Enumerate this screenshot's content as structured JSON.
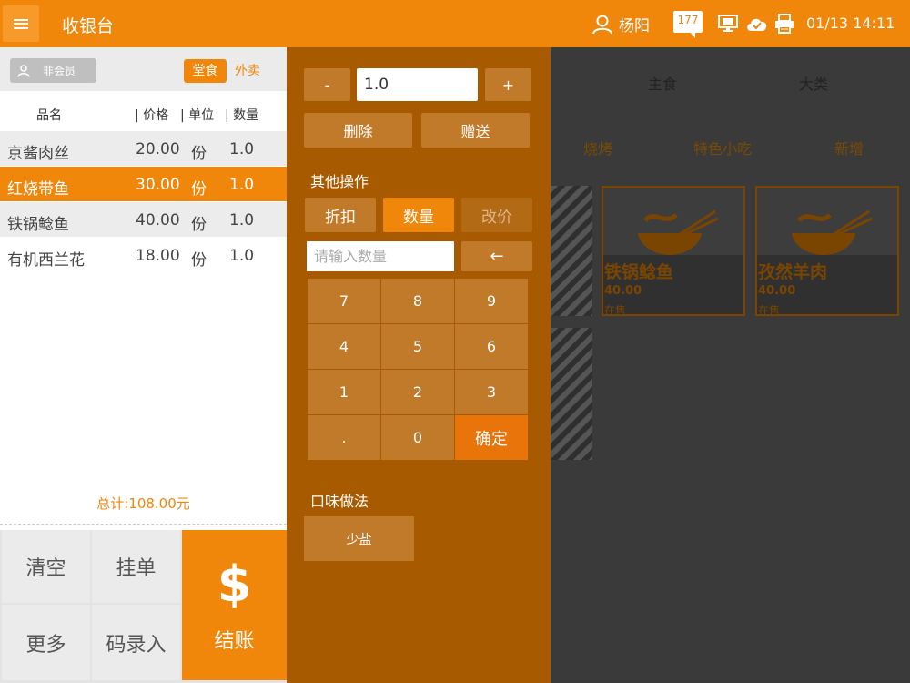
{
  "topbar": {
    "title": "收银台",
    "user_name": "杨阳",
    "message_count": "177",
    "datetime": "01/13 14:11"
  },
  "order_panel": {
    "member_label": "非会员",
    "tabs": {
      "dine_in": "堂食",
      "takeout": "外卖"
    },
    "columns": {
      "name": "品名",
      "price": "| 价格",
      "unit": "| 单位",
      "qty": "| 数量"
    },
    "items": [
      {
        "name": "京酱肉丝",
        "price": "20.00",
        "unit": "份",
        "qty": "1.0"
      },
      {
        "name": "红烧带鱼",
        "price": "30.00",
        "unit": "份",
        "qty": "1.0"
      },
      {
        "name": "铁锅鲶鱼",
        "price": "40.00",
        "unit": "份",
        "qty": "1.0"
      },
      {
        "name": "有机西兰花",
        "price": "18.00",
        "unit": "份",
        "qty": "1.0"
      }
    ],
    "selected_index": 1,
    "total": "总计:108.00元",
    "buttons": {
      "clear": "清空",
      "hold": "挂单",
      "more": "更多",
      "code_entry": "码录入",
      "checkout": "结账",
      "checkout_symbol": "$"
    }
  },
  "edit_panel": {
    "minus": "-",
    "plus": "+",
    "qty_value": "1.0",
    "delete": "删除",
    "gift": "赠送",
    "other_ops_label": "其他操作",
    "ops": {
      "discount": "折扣",
      "quantity": "数量",
      "change_price": "改价"
    },
    "numpad_placeholder": "请输入数量",
    "backspace": "←",
    "keys": [
      "7",
      "8",
      "9",
      "4",
      "5",
      "6",
      "1",
      "2",
      "3",
      ".",
      "0"
    ],
    "confirm": "确定",
    "taste_label": "口味做法",
    "taste_options": [
      "少盐"
    ]
  },
  "menu_panel": {
    "categories": [
      "主食",
      "大类"
    ],
    "subcategories": [
      "烧烤",
      "特色小吃",
      "新增"
    ],
    "cards": [
      {
        "name": "铁锅鲶鱼",
        "price": "40.00",
        "status": "在售"
      },
      {
        "name": "孜然羊肉",
        "price": "40.00",
        "status": "在售"
      }
    ]
  },
  "colors": {
    "accent": "#f0870a",
    "panel": "#a85a00",
    "key": "#c07a2a"
  }
}
